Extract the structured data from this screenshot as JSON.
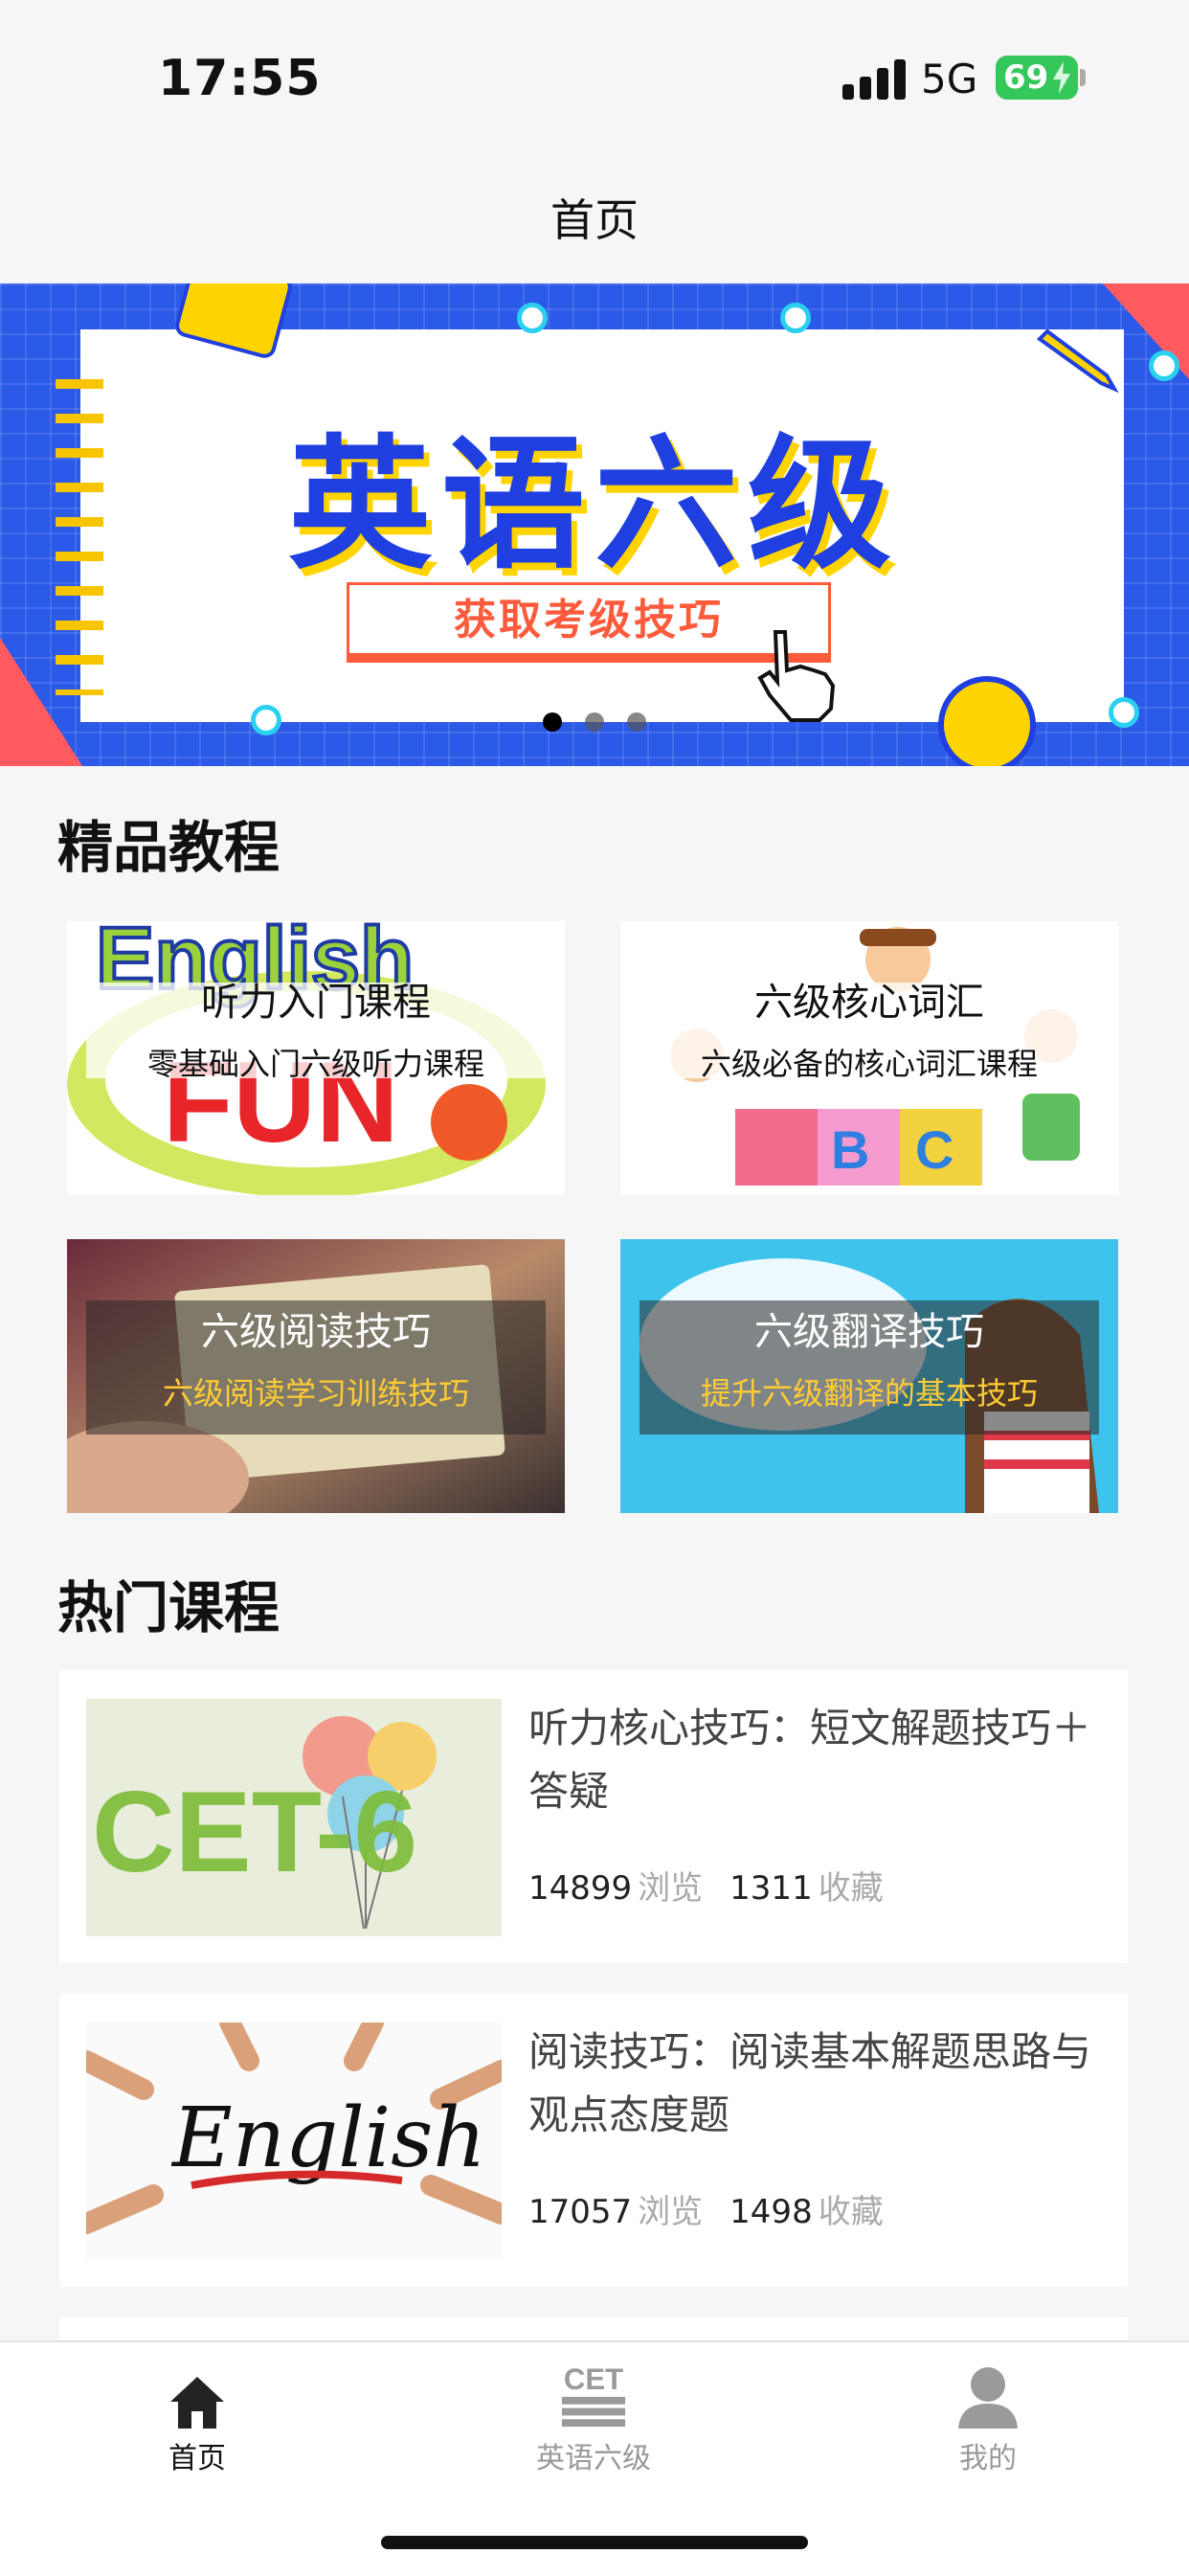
{
  "status_bar": {
    "time": "17:55",
    "network": "5G",
    "battery": "69"
  },
  "nav": {
    "title": "首页"
  },
  "banner": {
    "headline": "英语六级",
    "cta": "获取考级技巧",
    "pages": 3,
    "active_page": 1,
    "colors": {
      "background": "#2b59e8",
      "headline": "#1f3fe0",
      "accent": "#ffd400",
      "cta": "#ff5a3c"
    }
  },
  "featured": {
    "title": "精品教程",
    "items": [
      {
        "title": "听力入门课程",
        "subtitle": "零基础入门六级听力课程"
      },
      {
        "title": "六级核心词汇",
        "subtitle": "六级必备的核心词汇课程"
      },
      {
        "title": "六级阅读技巧",
        "subtitle": "六级阅读学习训练技巧"
      },
      {
        "title": "六级翻译技巧",
        "subtitle": "提升六级翻译的基本技巧"
      }
    ]
  },
  "hot": {
    "title": "热门课程",
    "items": [
      {
        "title": "听力核心技巧：短文解题技巧＋答疑",
        "views": "14899",
        "views_label": "浏览",
        "favs": "1311",
        "favs_label": "收藏",
        "thumb_text": "CET-6"
      },
      {
        "title": "阅读技巧：阅读基本解题思路与观点态度题",
        "views": "17057",
        "views_label": "浏览",
        "favs": "1498",
        "favs_label": "收藏",
        "thumb_text": "English"
      }
    ]
  },
  "tabbar": {
    "items": [
      {
        "label": "首页",
        "icon": "home-icon",
        "active": true
      },
      {
        "label": "英语六级",
        "icon": "cet-icon",
        "icon_text": "CET",
        "active": false
      },
      {
        "label": "我的",
        "icon": "user-icon",
        "active": false
      }
    ]
  }
}
